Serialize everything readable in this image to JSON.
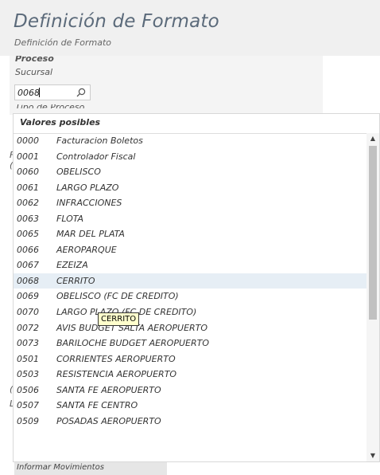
{
  "header": {
    "title": "Definición de Formato",
    "subtitle": "Definición de Formato"
  },
  "form": {
    "section_label": "Proceso",
    "field_label": "Sucursal",
    "field_value": "0068",
    "next_label": "Tipo de Proceso",
    "left_fragments": [
      "F",
      "(",
      "(",
      "L"
    ]
  },
  "dropdown": {
    "title": "Valores posibles",
    "selected_index": 9,
    "items": [
      {
        "code": "0000",
        "name": "Facturacion Boletos"
      },
      {
        "code": "0001",
        "name": "Controlador Fiscal"
      },
      {
        "code": "0060",
        "name": "OBELISCO"
      },
      {
        "code": "0061",
        "name": "LARGO PLAZO"
      },
      {
        "code": "0062",
        "name": "INFRACCIONES"
      },
      {
        "code": "0063",
        "name": "FLOTA"
      },
      {
        "code": "0065",
        "name": "MAR DEL PLATA"
      },
      {
        "code": "0066",
        "name": "AEROPARQUE"
      },
      {
        "code": "0067",
        "name": "EZEIZA"
      },
      {
        "code": "0068",
        "name": "CERRITO"
      },
      {
        "code": "0069",
        "name": "OBELISCO (FC DE CREDITO)"
      },
      {
        "code": "0070",
        "name": "LARGO PLAZO (FC DE CREDITO)"
      },
      {
        "code": "0072",
        "name": "AVIS BUDGET SALTA AEROPUERTO"
      },
      {
        "code": "0073",
        "name": "BARILOCHE BUDGET AEROPUERTO"
      },
      {
        "code": "0501",
        "name": "CORRIENTES AEROPUERTO"
      },
      {
        "code": "0503",
        "name": "RESISTENCIA AEROPUERTO"
      },
      {
        "code": "0506",
        "name": "SANTA FE AEROPUERTO"
      },
      {
        "code": "0507",
        "name": "SANTA FE CENTRO"
      },
      {
        "code": "0509",
        "name": "POSADAS AEROPUERTO"
      }
    ]
  },
  "tooltip": {
    "text": "CERRITO"
  },
  "footer": {
    "label": "Informar Movimientos"
  },
  "icons": {
    "search": "search-icon",
    "scroll_up": "triangle-up-icon",
    "scroll_down": "triangle-down-icon"
  }
}
